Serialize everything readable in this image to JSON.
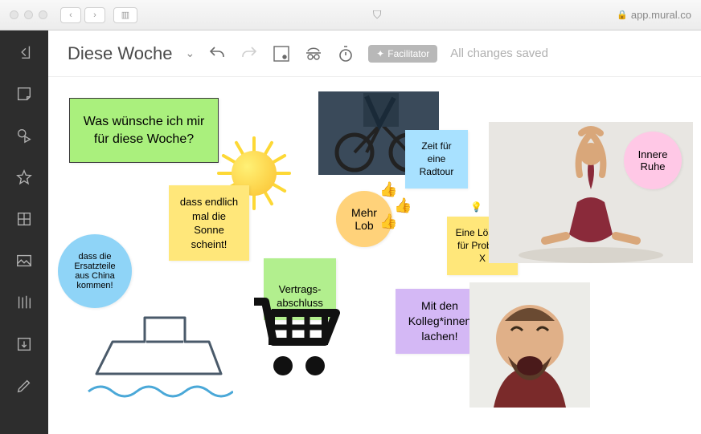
{
  "browser": {
    "url_host": "app.mural.co"
  },
  "toolbar": {
    "title": "Diese Woche",
    "facilitator_label": "Facilitator",
    "status": "All changes saved"
  },
  "notes": {
    "prompt": "Was wünsche ich mir für diese Woche?",
    "sun_wish": "dass endlich mal die Sonne scheint!",
    "spare_parts": "dass die Ersatzteile aus China kommen!",
    "contract": "Vertrags-\nabschluss",
    "bike": "Zeit für eine Radtour",
    "praise": "Mehr Lob",
    "solution": "Eine Lösung für Problem X",
    "laugh": "Mit den Kolleg*innen lachen!",
    "calm": "Innere Ruhe"
  },
  "icons": {
    "exit": "exit",
    "note": "sticky-note",
    "shape": "shape",
    "star": "star",
    "grid": "frameworks",
    "image": "image",
    "files": "files",
    "import": "import",
    "draw": "draw"
  }
}
